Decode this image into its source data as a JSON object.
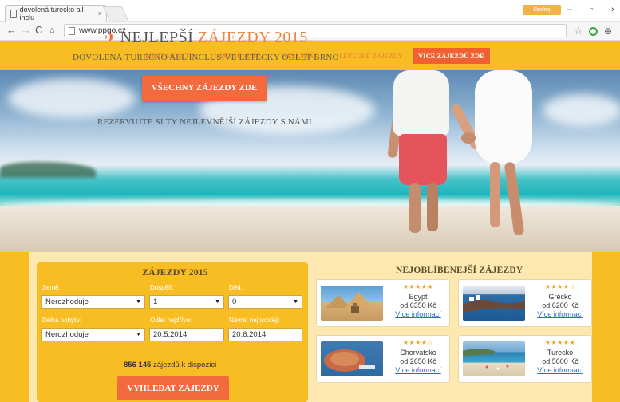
{
  "browser": {
    "tab_title": "dovolená turecko all inclu",
    "tab_close": "×",
    "profile_label": "Ondrej",
    "url": "www.ppgo.cz",
    "controls": {
      "minimize": "–",
      "restore": "▫",
      "close": "›"
    }
  },
  "nav": {
    "items": [
      "FIRST MINUTE",
      "LAST MINUTE",
      "WELLNESS",
      "LETECKÉ ZÁJEZDY"
    ],
    "cta": "VÍCE ZÁJEZDŮ ZDE"
  },
  "hero": {
    "title_plain": "NEJLEPŠÍ",
    "title_accent": "ZÁJEZDY 2015",
    "subtitle": "DOVOLENÁ TURECKO ALL INCLUSIVE LETECKY ODLET BRNO",
    "button": "VŠECHNY ZÁJEZDY ZDE",
    "tagline": "REZERVUJTE SI TY NEJLEVNĚJŠÍ ZÁJEZDY S NÁMI"
  },
  "search": {
    "title": "ZÁJEZDY 2015",
    "fields": {
      "zeme": {
        "label": "Země:",
        "value": "Nerozhoduje"
      },
      "dospeli": {
        "label": "Dospělí:",
        "value": "1"
      },
      "deti": {
        "label": "Děti:",
        "value": "0"
      },
      "delka": {
        "label": "Délka pobytu:",
        "value": "Nerozhoduje"
      },
      "odlet": {
        "label": "Odlet nejdříve:",
        "value": "20.5.2014"
      },
      "navrat": {
        "label": "Návrat nejpozději:",
        "value": "20.6.2014"
      }
    },
    "count_number": "856 145",
    "count_text": "zájezdů k dispozici",
    "button": "VYHLEDAT ZÁJEZDY"
  },
  "popular": {
    "title": "NEJOBLÍBENEJŠÍ ZÁJEZDY",
    "cards": [
      {
        "stars": "★★★★★",
        "rating": 4.5,
        "name": "Egypt",
        "price": "od 6350 Kč",
        "link": "Více informací"
      },
      {
        "stars": "★★★★☆",
        "rating": 4,
        "name": "Grécko",
        "price": "od 6200 Kč",
        "link": "Více informací"
      },
      {
        "stars": "★★★★☆",
        "rating": 4,
        "name": "Chorvatsko",
        "price": "od 2650 Kč",
        "link": "Více informací"
      },
      {
        "stars": "★★★★★",
        "rating": 5,
        "name": "Turecko",
        "price": "od 5600 Kč",
        "link": "Více informací"
      }
    ]
  },
  "colors": {
    "accent": "#f26a3d",
    "brand_yellow": "#f7bd22",
    "link": "#2a6ac8"
  }
}
